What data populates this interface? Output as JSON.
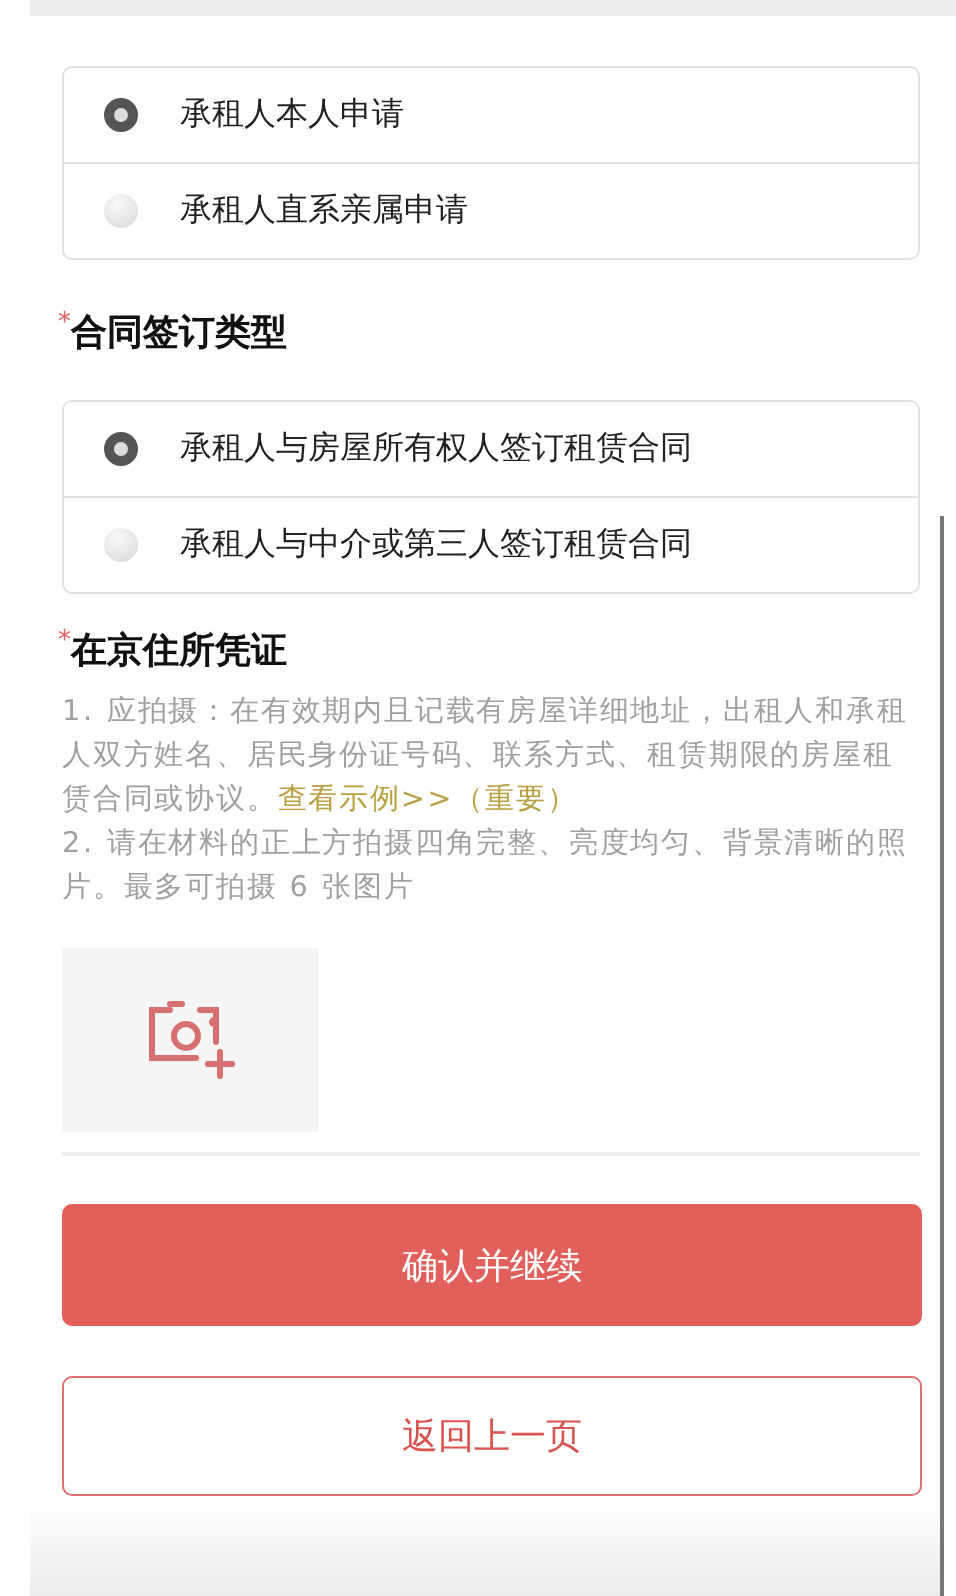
{
  "applicant_options": [
    {
      "label": "承租人本人申请",
      "selected": true
    },
    {
      "label": "承租人直系亲属申请",
      "selected": false
    }
  ],
  "contract_section": {
    "required_mark": "*",
    "title": "合同签订类型",
    "options": [
      {
        "label": "承租人与房屋所有权人签订租赁合同",
        "selected": true
      },
      {
        "label": "承租人与中介或第三人签订租赁合同",
        "selected": false
      }
    ]
  },
  "residence_section": {
    "required_mark": "*",
    "title": "在京住所凭证",
    "notes": [
      {
        "text": "1. 应拍摄：在有效期内且记载有房屋详细地址，出租人和承租人双方姓名、居民身份证号码、联系方式、租赁期限的房屋租赁合同或协议。",
        "link": "查看示例>>（重要）"
      },
      {
        "text": "2. 请在材料的正上方拍摄四角完整、亮度均匀、背景清晰的照片。最多可拍摄 6 张图片"
      }
    ]
  },
  "buttons": {
    "confirm": "确认并继续",
    "back": "返回上一页"
  }
}
